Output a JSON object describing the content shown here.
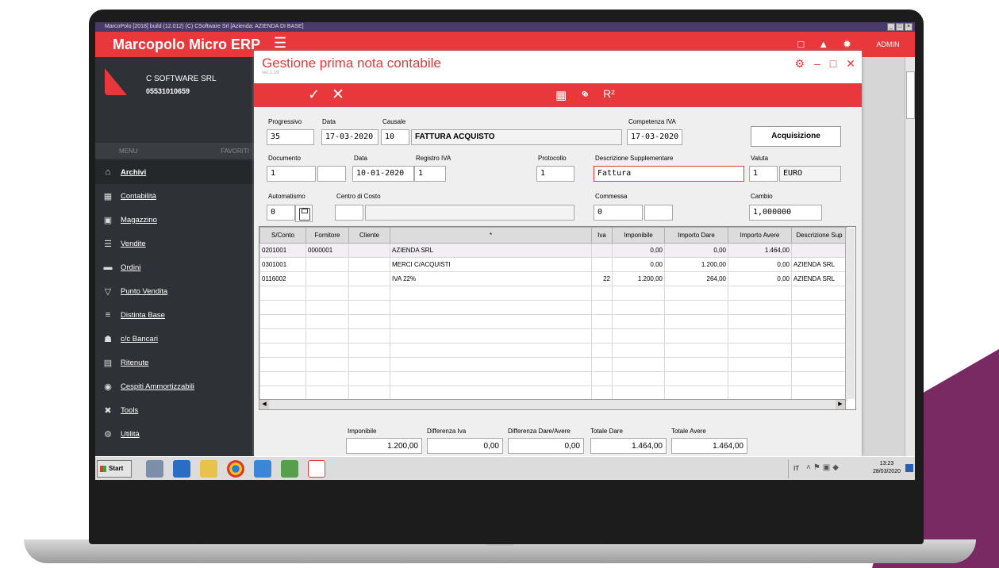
{
  "window": {
    "title": "MarcoPolo [2018] build (12.012) (C) CSoftware Srl  [Azienda: AZIENDA DI BASE]",
    "buttons": [
      "_",
      "□",
      "×"
    ]
  },
  "app": {
    "title": "Marcopolo Micro ERP",
    "user": "ADMIN"
  },
  "company": {
    "name": "C SOFTWARE SRL",
    "vat": "05531010659"
  },
  "sidebar": {
    "menu_label": "MENU",
    "favorites_label": "FAVORITI",
    "items": [
      {
        "label": "Archivi",
        "icon": "archive-icon",
        "glyph": "⌂"
      },
      {
        "label": "Contabilità",
        "icon": "calculator-icon",
        "glyph": "▦"
      },
      {
        "label": "Magazzino",
        "icon": "warehouse-icon",
        "glyph": "▣"
      },
      {
        "label": "Vendite",
        "icon": "list-icon",
        "glyph": "☰"
      },
      {
        "label": "Ordini",
        "icon": "truck-icon",
        "glyph": "▬"
      },
      {
        "label": "Punto Vendita",
        "icon": "cart-icon",
        "glyph": "▽"
      },
      {
        "label": "Distinta Base",
        "icon": "list-lines-icon",
        "glyph": "≡"
      },
      {
        "label": "c/c Bancari",
        "icon": "bank-icon",
        "glyph": "☗"
      },
      {
        "label": "Ritenute",
        "icon": "briefcase-icon",
        "glyph": "▤"
      },
      {
        "label": "Cespiti Ammortizzabili",
        "icon": "car-icon",
        "glyph": "◉"
      },
      {
        "label": "Tools",
        "icon": "tools-icon",
        "glyph": "✖"
      },
      {
        "label": "Utilità",
        "icon": "gear-icon",
        "glyph": "⚙"
      }
    ]
  },
  "dialog": {
    "title": "Gestione prima nota contabile",
    "version": "ver.1.19"
  },
  "form": {
    "progressivo": {
      "label": "Progressivo",
      "value": "35"
    },
    "data": {
      "label": "Data",
      "value": "17-03-2020"
    },
    "causale": {
      "label": "Causale",
      "code": "10",
      "desc": "FATTURA ACQUISTO"
    },
    "competenza": {
      "label": "Competenza IVA",
      "value": "17-03-2020"
    },
    "acquisizione": "Acquisizione",
    "documento": {
      "label": "Documento",
      "value": "1",
      "value2": ""
    },
    "data_doc": {
      "label": "Data",
      "value": "10-01-2020"
    },
    "registro": {
      "label": "Registro IVA",
      "value": "1"
    },
    "protocollo": {
      "label": "Protocollo",
      "value": "1"
    },
    "descr_supp": {
      "label": "Descrizione Supplementare",
      "value": "Fattura"
    },
    "valuta": {
      "label": "Valuta",
      "code": "1",
      "desc": "EURO"
    },
    "automatismo": {
      "label": "Automatismo",
      "value": "0"
    },
    "centro": {
      "label": "Centro di Costo",
      "code": "",
      "desc": ""
    },
    "commessa": {
      "label": "Commessa",
      "value": "0",
      "value2": ""
    },
    "cambio": {
      "label": "Cambio",
      "value": "1,000000"
    }
  },
  "grid": {
    "columns": [
      "S/Conto",
      "Fornitore",
      "Cliente",
      "*",
      "Iva",
      "Imponibile",
      "Importo Dare",
      "Importo Avere",
      "Descrizione Sup"
    ],
    "rows": [
      [
        "0201001",
        "0000001",
        "",
        "AZIENDA SRL",
        "",
        "0,00",
        "0,00",
        "1.464,00",
        ""
      ],
      [
        "0301001",
        "",
        "",
        "MERCI C/ACQUISTI",
        "",
        "0,00",
        "1.200,00",
        "0,00",
        "AZIENDA SRL"
      ],
      [
        "0116002",
        "",
        "",
        "IVA 22%",
        "22",
        "1.200,00",
        "264,00",
        "0,00",
        "AZIENDA SRL"
      ]
    ]
  },
  "totals": {
    "imponibile": {
      "label": "Imponibile",
      "value": "1.200,00"
    },
    "diff_iva": {
      "label": "Differenza Iva",
      "value": "0,00"
    },
    "diff_dare_avere": {
      "label": "Differenza Dare/Avere",
      "value": "0,00"
    },
    "totale_dare": {
      "label": "Totale Dare",
      "value": "1.464,00"
    },
    "totale_avere": {
      "label": "Totale Avere",
      "value": "1.464,00"
    }
  },
  "taskbar": {
    "start": "Start",
    "language": "IT",
    "time": "13:23",
    "date": "28/03/2020"
  },
  "colors": {
    "accent": "#e8383b",
    "sidebar": "#2e3236",
    "brand_purple": "#7a2a63"
  }
}
